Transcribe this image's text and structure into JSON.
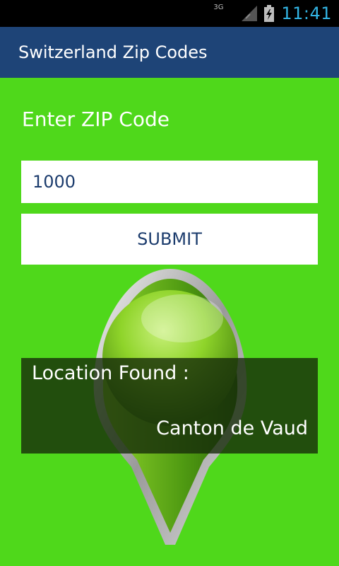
{
  "status_bar": {
    "network": "3G",
    "time": "11:41",
    "icons": [
      "signal-icon",
      "battery-charging-icon"
    ]
  },
  "action_bar": {
    "title": "Switzerland Zip Codes"
  },
  "form": {
    "label": "Enter ZIP  Code",
    "zip_value": "1000",
    "submit_label": "SUBMIT"
  },
  "result": {
    "title": "Location Found :",
    "value": "Canton de Vaud"
  },
  "colors": {
    "background": "#4fd81b",
    "action_bar": "#1e4477",
    "clock": "#33b5e5",
    "button_text": "#1c3c6d"
  },
  "graphic": "map-pin-icon"
}
